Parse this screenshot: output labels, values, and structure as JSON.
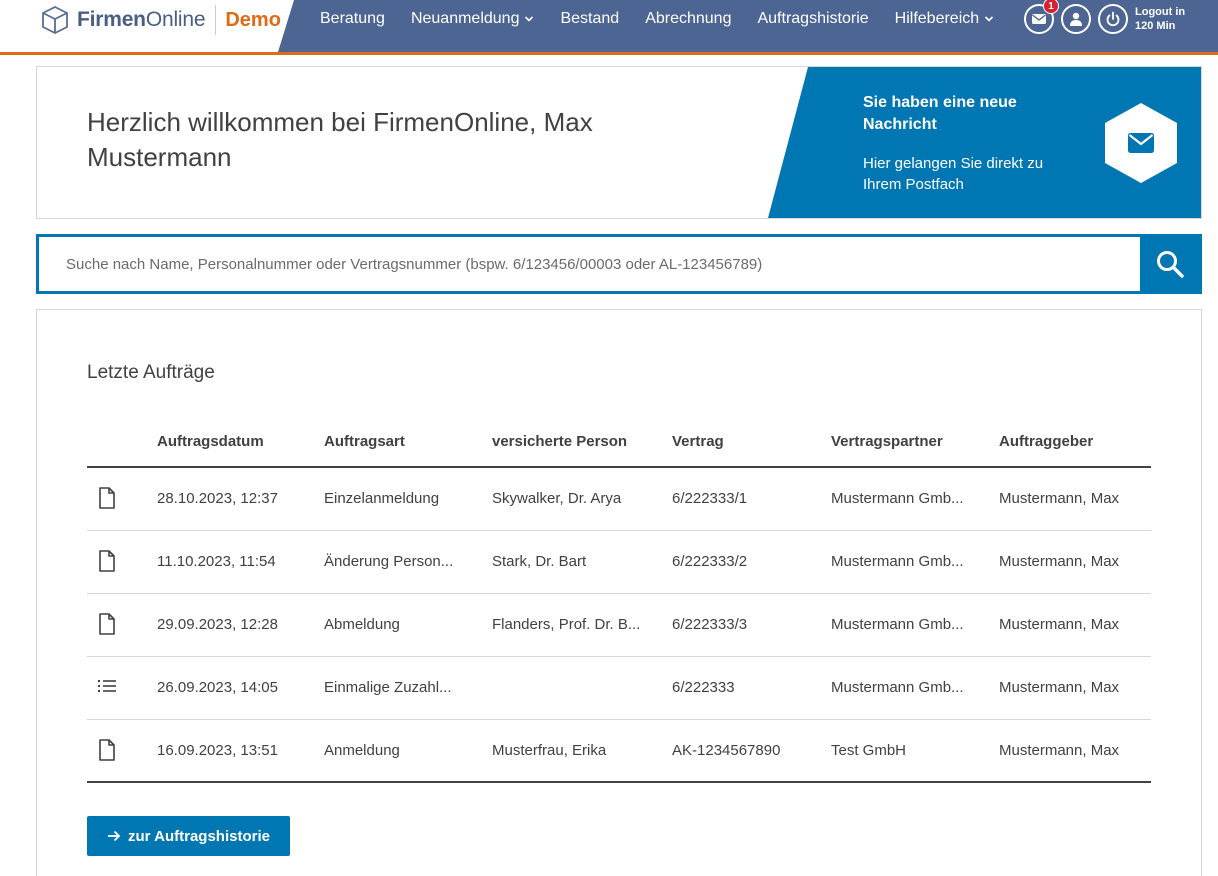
{
  "header": {
    "logo_bold": "Firmen",
    "logo_light": "Online",
    "logo_demo": "Demo",
    "nav": [
      {
        "label": "Beratung",
        "dropdown": false
      },
      {
        "label": "Neuanmeldung",
        "dropdown": true
      },
      {
        "label": "Bestand",
        "dropdown": false
      },
      {
        "label": "Abrechnung",
        "dropdown": false
      },
      {
        "label": "Auftragshistorie",
        "dropdown": false
      },
      {
        "label": "Hilfebereich",
        "dropdown": true
      }
    ],
    "mail_badge": "1",
    "logout_line1": "Logout in",
    "logout_line2": "120 Min"
  },
  "welcome": {
    "title": "Herzlich willkommen bei FirmenOnline, Max Mustermann",
    "message_title": "Sie haben eine neue Nachricht",
    "message_sub": "Hier gelangen Sie direkt zu Ihrem Postfach"
  },
  "search": {
    "placeholder": "Suche nach Name, Personalnummer oder Vertragsnummer (bspw. 6/123456/00003 oder AL-123456789)",
    "value": ""
  },
  "orders": {
    "title": "Letzte Aufträge",
    "columns": [
      "Auftragsdatum",
      "Auftragsart",
      "versicherte Person",
      "Vertrag",
      "Vertragspartner",
      "Auftraggeber"
    ],
    "rows": [
      {
        "icon": "document-icon",
        "date": "28.10.2023, 12:37",
        "type": "Einzelanmeldung",
        "person": "Skywalker, Dr. Arya",
        "contract": "6/222333/1",
        "partner": "Mustermann Gmb...",
        "client": "Mustermann, Max"
      },
      {
        "icon": "document-icon",
        "date": "11.10.2023, 11:54",
        "type": "Änderung Person...",
        "person": "Stark, Dr. Bart",
        "contract": "6/222333/2",
        "partner": "Mustermann Gmb...",
        "client": "Mustermann, Max"
      },
      {
        "icon": "document-icon",
        "date": "29.09.2023, 12:28",
        "type": "Abmeldung",
        "person": "Flanders, Prof. Dr. B...",
        "contract": "6/222333/3",
        "partner": "Mustermann Gmb...",
        "client": "Mustermann, Max"
      },
      {
        "icon": "list-icon",
        "date": "26.09.2023, 14:05",
        "type": "Einmalige Zuzahl...",
        "person": "",
        "contract": "6/222333",
        "partner": "Mustermann Gmb...",
        "client": "Mustermann, Max"
      },
      {
        "icon": "document-icon",
        "date": "16.09.2023, 13:51",
        "type": "Anmeldung",
        "person": "Musterfrau, Erika",
        "contract": "AK-1234567890",
        "partner": "Test GmbH",
        "client": "Mustermann, Max"
      }
    ],
    "history_button": "zur Auftragshistorie"
  },
  "colors": {
    "nav_bg": "#4d6592",
    "accent_orange": "#e06a17",
    "primary_blue": "#0077b3",
    "badge_red": "#d82030"
  }
}
